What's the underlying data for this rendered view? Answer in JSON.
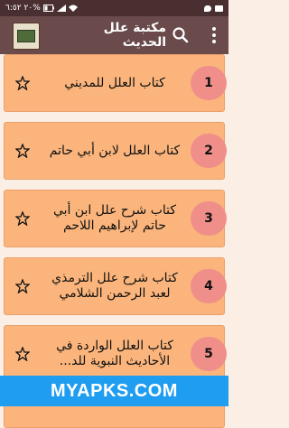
{
  "statusbar": {
    "time": "٦:٥٢",
    "battery": "٢٠%"
  },
  "appbar": {
    "title": "مكتبة علل الحديث"
  },
  "books": [
    {
      "number": "1",
      "title": "كتاب العلل للمديني"
    },
    {
      "number": "2",
      "title": "كتاب العلل لابن أبي حاتم"
    },
    {
      "number": "3",
      "title": "كتاب شرح علل ابن أبي حاتم لإبراهيم اللاحم"
    },
    {
      "number": "4",
      "title": "كتاب شرح علل الترمذي لعبد الرحمن الشلامي"
    },
    {
      "number": "5",
      "title": "كتاب العلل الواردة في الأحاديث النبوية للد..."
    }
  ],
  "watermark": "MYAPKS.COM",
  "colors": {
    "appbar": "#6a4a4b",
    "card": "#fbb57c",
    "number_badge": "#f08f8a",
    "watermark": "#1f9df0"
  }
}
